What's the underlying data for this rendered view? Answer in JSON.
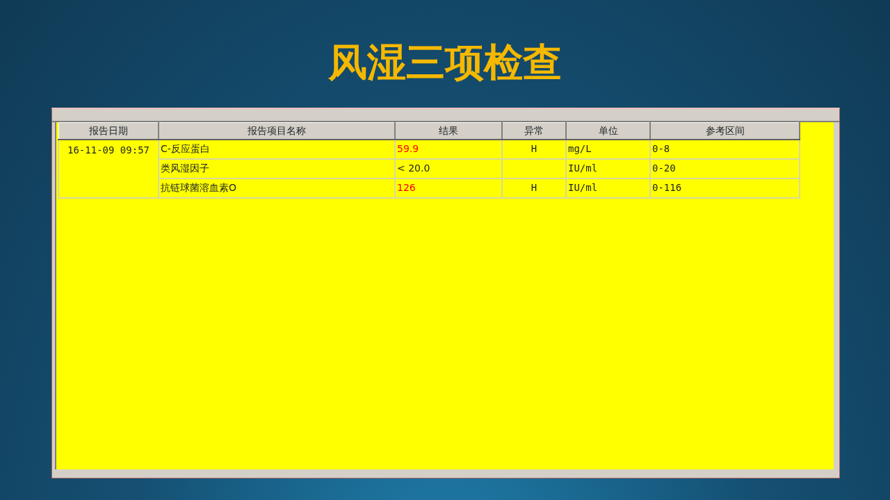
{
  "slide_title": "风湿三项检查",
  "table": {
    "columns": [
      "报告日期",
      "报告项目名称",
      "结果",
      "异常",
      "单位",
      "参考区间"
    ],
    "rows": [
      {
        "date": "16-11-09 09:57",
        "item": "C-反应蛋白",
        "result": "59.9",
        "abnormal": true,
        "flag": "H",
        "unit": "mg/L",
        "range": "0-8"
      },
      {
        "item": "类风湿因子",
        "result": "< 20.0",
        "abnormal": false,
        "unit": "IU/ml",
        "range": "0-20"
      },
      {
        "item": "抗链球菌溶血素O",
        "result": "126",
        "abnormal": true,
        "flag": "H",
        "unit": "IU/ml",
        "range": "0-116"
      }
    ]
  }
}
